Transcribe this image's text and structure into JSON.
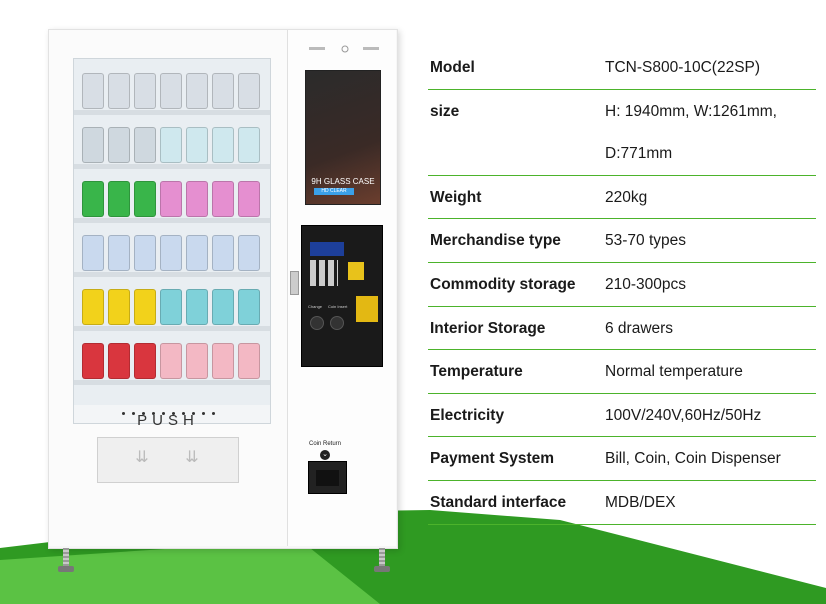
{
  "colors": {
    "accent_green": "#4cb32b",
    "bg_green_dark": "#2f9a22",
    "bg_green_light": "#63c94a"
  },
  "machine": {
    "push_label": "PUSH",
    "screen_text": "9H GLASS CASE",
    "screen_badge": "HD CLEAR",
    "coin_return_label": "Coin Return",
    "panel_labels": [
      "Change",
      "Coin Insert"
    ]
  },
  "spec": {
    "rows": [
      {
        "label": "Model",
        "value": "TCN-S800-10C(22SP)"
      },
      {
        "label": "size",
        "value": "H: 1940mm, W:1261mm,"
      },
      {
        "label": "",
        "value": "D:771mm"
      },
      {
        "label": "Weight",
        "value": "220kg"
      },
      {
        "label": "Merchandise type",
        "value": "53-70 types"
      },
      {
        "label": "Commodity storage",
        "value": "210-300pcs"
      },
      {
        "label": "Interior Storage",
        "value": "6 drawers"
      },
      {
        "label": "Temperature",
        "value": "Normal temperature"
      },
      {
        "label": "Electricity",
        "value": "100V/240V,60Hz/50Hz"
      },
      {
        "label": "Payment System",
        "value": "Bill, Coin, Coin Dispenser"
      },
      {
        "label": "Standard interface",
        "value": "MDB/DEX"
      }
    ]
  }
}
